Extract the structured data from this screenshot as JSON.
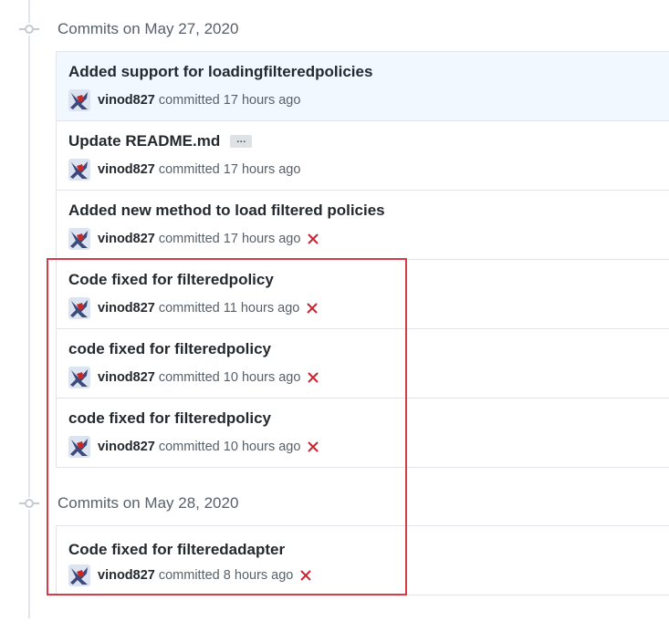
{
  "groups": [
    {
      "date_label": "Commits on May 27, 2020",
      "commits": [
        {
          "title": "Added support for loadingfilteredpolicies",
          "author": "vinod827",
          "action": "committed",
          "time": "17 hours ago",
          "status": "none",
          "highlighted": true,
          "has_ellipsis": false
        },
        {
          "title": "Update README.md",
          "author": "vinod827",
          "action": "committed",
          "time": "17 hours ago",
          "status": "none",
          "highlighted": false,
          "has_ellipsis": true,
          "ellipsis_label": "…"
        },
        {
          "title": "Added new method to load filtered policies",
          "author": "vinod827",
          "action": "committed",
          "time": "17 hours ago",
          "status": "failure",
          "highlighted": false,
          "has_ellipsis": false
        },
        {
          "title": "Code fixed for filteredpolicy",
          "author": "vinod827",
          "action": "committed",
          "time": "11 hours ago",
          "status": "failure",
          "highlighted": false,
          "has_ellipsis": false
        },
        {
          "title": "code fixed for filteredpolicy",
          "author": "vinod827",
          "action": "committed",
          "time": "10 hours ago",
          "status": "failure",
          "highlighted": false,
          "has_ellipsis": false
        },
        {
          "title": "code fixed for filteredpolicy",
          "author": "vinod827",
          "action": "committed",
          "time": "10 hours ago",
          "status": "failure",
          "highlighted": false,
          "has_ellipsis": false
        }
      ]
    },
    {
      "date_label": "Commits on May 28, 2020",
      "commits": [
        {
          "title": "Code fixed for filteredadapter",
          "author": "vinod827",
          "action": "committed",
          "time": "8 hours ago",
          "status": "failure",
          "highlighted": false,
          "has_ellipsis": false
        }
      ]
    }
  ],
  "colors": {
    "failure": "#cb2431",
    "annotation_box": "#d73a49",
    "highlight_row": "#f1f8ff"
  },
  "icons": {
    "group_marker": "commit-node-icon",
    "status_failure": "x-icon",
    "avatar": "user-avatar"
  }
}
